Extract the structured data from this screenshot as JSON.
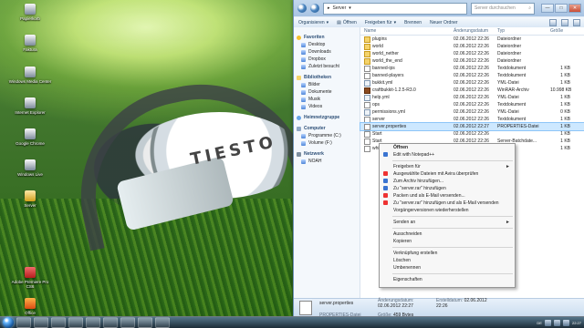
{
  "desktop": {
    "icons": [
      {
        "label": "Papierkorb",
        "kind": "bin"
      },
      {
        "label": "Faktura",
        "kind": "doc"
      },
      {
        "label": "Windows Media Center",
        "kind": "doc"
      },
      {
        "label": "Internet Explorer",
        "kind": "doc"
      },
      {
        "label": "Google Chrome",
        "kind": "doc"
      },
      {
        "label": "Windows Live",
        "kind": "doc"
      },
      {
        "label": "Server",
        "kind": "folder"
      },
      {
        "label": "Adobe Premiere Pro CS6",
        "kind": "pdf"
      },
      {
        "label": "Office",
        "kind": "office"
      }
    ],
    "brand": "TIESTO"
  },
  "explorer": {
    "address": [
      "Server"
    ],
    "search_placeholder": "Server durchsuchen",
    "toolbar": {
      "organize": "Organisieren",
      "open": "Öffnen",
      "share": "Freigeben für",
      "burn": "Brennen",
      "new_folder": "Neuer Ordner"
    },
    "sidebar": {
      "favorites": "Favoriten",
      "favorites_items": [
        "Desktop",
        "Downloads",
        "Dropbox",
        "Zuletzt besucht"
      ],
      "libraries": "Bibliotheken",
      "library_items": [
        "Bilder",
        "Dokumente",
        "Musik",
        "Videos"
      ],
      "homegroup": "Heimnetzgruppe",
      "computer": "Computer",
      "computer_items": [
        "Programme (C:)",
        "Volume (F:)"
      ],
      "network": "Netzwerk",
      "network_items": [
        "NOAH"
      ]
    },
    "columns": {
      "name": "Name",
      "date": "Änderungsdatum",
      "type": "Typ",
      "size": "Größe"
    },
    "files": [
      {
        "name": "plugins",
        "date": "02.06.2012 22:26",
        "type": "Dateiordner",
        "size": "",
        "kind": "folder"
      },
      {
        "name": "world",
        "date": "02.06.2012 22:26",
        "type": "Dateiordner",
        "size": "",
        "kind": "folder"
      },
      {
        "name": "world_nether",
        "date": "02.06.2012 22:26",
        "type": "Dateiordner",
        "size": "",
        "kind": "folder"
      },
      {
        "name": "world_the_end",
        "date": "02.06.2012 22:26",
        "type": "Dateiordner",
        "size": "",
        "kind": "folder"
      },
      {
        "name": "banned-ips",
        "date": "02.06.2012 22:26",
        "type": "Textdokument",
        "size": "1 KB",
        "kind": "txt"
      },
      {
        "name": "banned-players",
        "date": "02.06.2012 22:26",
        "type": "Textdokument",
        "size": "1 KB",
        "kind": "txt"
      },
      {
        "name": "bukkit.yml",
        "date": "02.06.2012 22:26",
        "type": "YML-Datei",
        "size": "1 KB",
        "kind": "yml"
      },
      {
        "name": "craftbukkit-1.2.5-R3.0",
        "date": "02.06.2012 22:26",
        "type": "WinRAR-Archiv",
        "size": "10.998 KB",
        "kind": "jar"
      },
      {
        "name": "help.yml",
        "date": "02.06.2012 22:26",
        "type": "YML-Datei",
        "size": "1 KB",
        "kind": "yml"
      },
      {
        "name": "ops",
        "date": "02.06.2012 22:26",
        "type": "Textdokument",
        "size": "1 KB",
        "kind": "txt"
      },
      {
        "name": "permissions.yml",
        "date": "02.06.2012 22:26",
        "type": "YML-Datei",
        "size": "0 KB",
        "kind": "yml"
      },
      {
        "name": "server",
        "date": "02.06.2012 22:26",
        "type": "Textdokument",
        "size": "1 KB",
        "kind": "txt"
      },
      {
        "name": "server.properties",
        "date": "02.06.2012 22:27",
        "type": "PROPERTIES-Datei",
        "size": "1 KB",
        "kind": "txt",
        "selected": true
      },
      {
        "name": "Start",
        "date": "02.06.2012 22:26",
        "type": "",
        "size": "1 KB",
        "kind": "txt"
      },
      {
        "name": "Start",
        "date": "02.06.2012 22:26",
        "type": "Server-Batchdate...",
        "size": "1 KB",
        "kind": "txt"
      },
      {
        "name": "white-",
        "date": "02.06.2012 22:26",
        "type": "",
        "size": "1 KB",
        "kind": "txt"
      }
    ],
    "details": {
      "filename": "server.properties",
      "filetype": "PROPERTIES-Datei",
      "modified_label": "Änderungsdatum:",
      "modified": "02.06.2012 22:27",
      "size_label": "Größe:",
      "size": "459 Bytes",
      "created_label": "Erstelldatum:",
      "created": "02.06.2012 22:26"
    }
  },
  "context_menu": {
    "items": [
      {
        "label": "Öffnen",
        "bold": true,
        "icon": ""
      },
      {
        "label": "Edit with Notepad++",
        "icon": "blue"
      },
      {
        "separator": true
      },
      {
        "label": "Freigeben für",
        "arrow": "►"
      },
      {
        "label": "Ausgewählte Dateien mit Avira überprüfen",
        "icon": "red"
      },
      {
        "label": "Zum Archiv hinzufügen...",
        "icon": "blue"
      },
      {
        "label": "Zu \"server.rar\" hinzufügen",
        "icon": "blue"
      },
      {
        "label": "Packen und als E-Mail versenden...",
        "icon": "red"
      },
      {
        "label": "Zu \"server.rar\" hinzufügen und als E-Mail versenden",
        "icon": "red"
      },
      {
        "label": "Vorgängerversionen wiederherstellen"
      },
      {
        "separator": true
      },
      {
        "label": "Senden an",
        "arrow": "►"
      },
      {
        "separator": true
      },
      {
        "label": "Ausschneiden"
      },
      {
        "label": "Kopieren"
      },
      {
        "separator": true
      },
      {
        "label": "Verknüpfung erstellen"
      },
      {
        "label": "Löschen"
      },
      {
        "label": "Umbenennen"
      },
      {
        "separator": true
      },
      {
        "label": "Eigenschaften"
      }
    ]
  },
  "taskbar": {
    "time": "22:27",
    "lang": "DE"
  }
}
